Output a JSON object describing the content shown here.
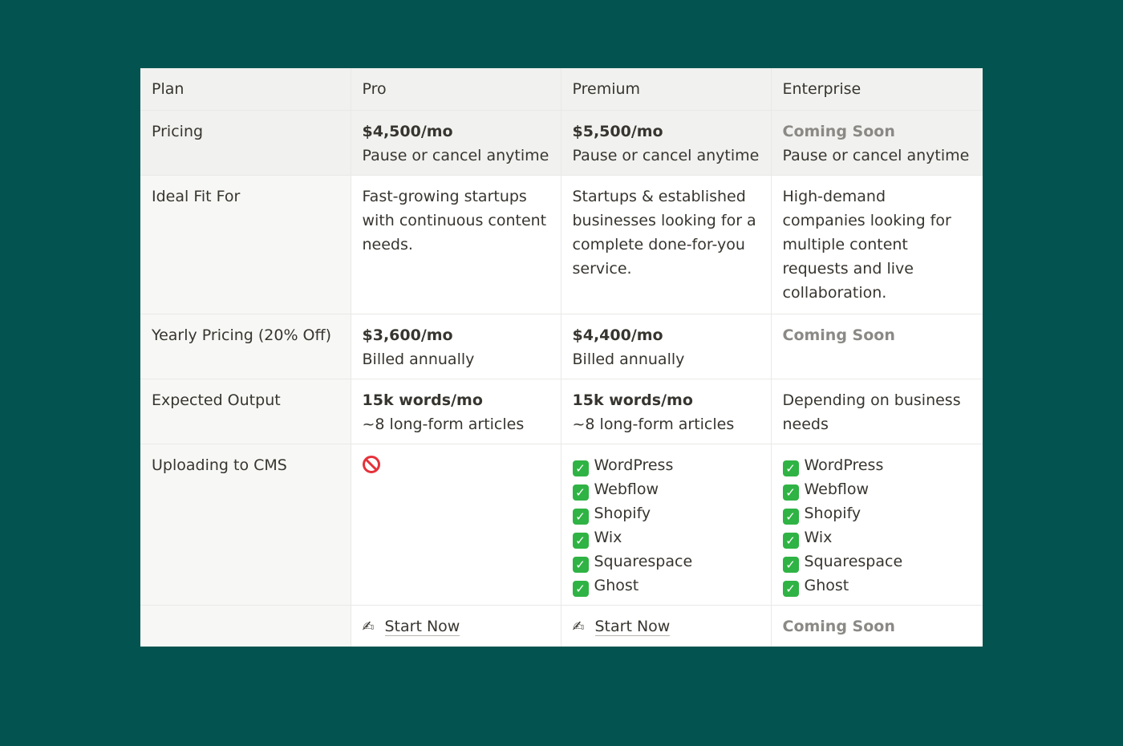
{
  "table": {
    "headers": [
      "Plan",
      "Pro",
      "Premium",
      "Enterprise"
    ],
    "pricing": {
      "label": "Pricing",
      "pro": {
        "price": "$4,500/mo",
        "note": "Pause or cancel anytime"
      },
      "premium": {
        "price": "$5,500/mo",
        "note": "Pause or cancel anytime"
      },
      "enterprise": {
        "price": "Coming Soon",
        "note": "Pause or cancel anytime"
      }
    },
    "ideal_fit": {
      "label": "Ideal Fit For",
      "pro": "Fast-growing startups with continuous content needs.",
      "premium": "Startups & established businesses looking for a complete done-for-you service.",
      "enterprise": "High-demand companies looking for multiple content requests and live collaboration."
    },
    "yearly": {
      "label": "Yearly Pricing (20% Off)",
      "pro": {
        "price": "$3,600/mo",
        "note": "Billed annually"
      },
      "premium": {
        "price": "$4,400/mo",
        "note": "Billed annually"
      },
      "enterprise": {
        "price": "Coming Soon"
      }
    },
    "output": {
      "label": "Expected Output",
      "pro": {
        "words": "15k words/mo",
        "articles": "~8 long-form articles"
      },
      "premium": {
        "words": "15k words/mo",
        "articles": "~8 long-form articles"
      },
      "enterprise": {
        "text": "Depending on business needs"
      }
    },
    "cms": {
      "label": "Uploading to CMS",
      "pro_icon": "no-entry-icon",
      "platforms": [
        "WordPress",
        "Webflow",
        "Shopify",
        "Wix",
        "Squarespace",
        "Ghost"
      ]
    },
    "cta": {
      "pro": "Start Now",
      "premium": "Start Now",
      "enterprise": "Coming Soon"
    }
  },
  "colors": {
    "background": "#035450",
    "header_bg": "#f1f1ef",
    "muted_text": "#8a8985",
    "check": "#2fb344",
    "no_entry": "#e5323b"
  }
}
